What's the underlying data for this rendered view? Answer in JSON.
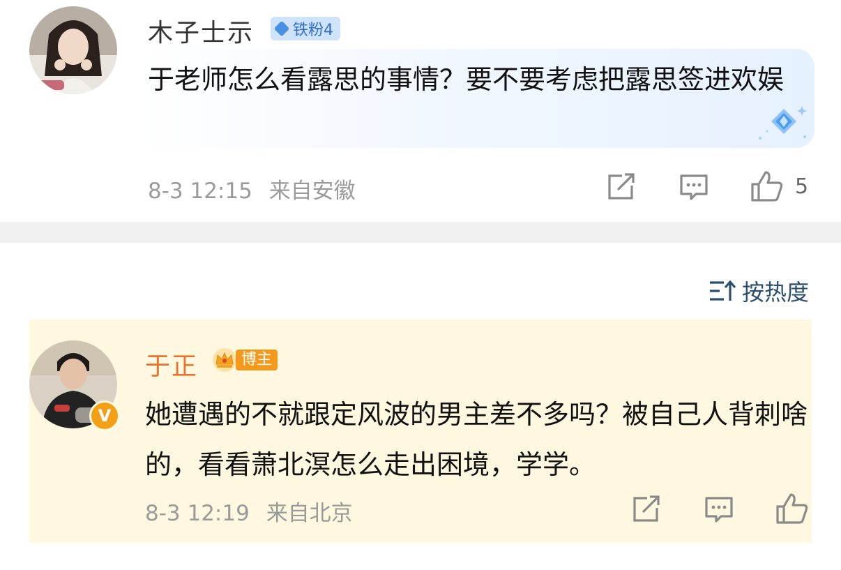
{
  "comment1": {
    "username": "木子士示",
    "badge": "铁粉4",
    "text": "于老师怎么看露思的事情？要不要考虑把露思签进欢娱",
    "time": "8-3 12:15",
    "location": "来自安徽",
    "likes": "5",
    "icons": [
      "share-icon",
      "comment-icon",
      "like-icon"
    ]
  },
  "sort": {
    "label": "按热度",
    "icon": "sort-icon"
  },
  "comment2": {
    "username": "于正",
    "badge": "博主",
    "verified": "V",
    "text": "她遭遇的不就跟定风波的男主差不多吗？被自己人背刺啥的，看看萧北溟怎么走出困境，学学。",
    "time": "8-3 12:19",
    "location": "来自北京",
    "icons": [
      "share-icon",
      "comment-icon",
      "like-icon"
    ]
  },
  "colors": {
    "fan_badge_bg": "#cfe3fb",
    "fan_badge_text": "#2e6fc7",
    "blogger_name": "#e8732c",
    "blogger_badge": "#f39a1c",
    "highlight_bg": "#fdf8df",
    "divider": "#f0f0f0",
    "meta_gray": "#9a9a9a",
    "sort_text": "#2a4f6e"
  }
}
